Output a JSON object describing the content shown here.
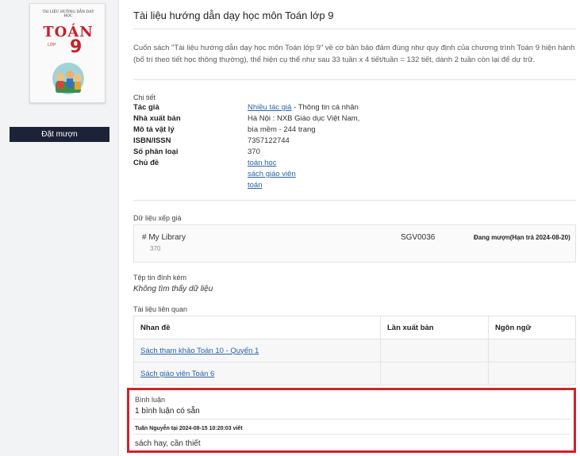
{
  "book": {
    "cover_title": "TOÁN",
    "cover_top_text": "TÀI LIỆU HƯỚNG DẪN DẠY HỌC",
    "cover_grade_label": "LỚP",
    "cover_grade_number": "9"
  },
  "actions": {
    "borrow_label": "Đặt mượn"
  },
  "header": {
    "title": "Tài liệu hướng dẫn dạy học môn Toán lớp 9",
    "description": "Cuốn sách \"Tài liệu hướng dẫn dạy học môn Toán lớp 9\" về cơ bản bảo đảm đúng như quy định của chương trình Toán 9 hiện hành (bố trí theo tiết học thông thường), thể hiện cụ thể như sau 33 tuần x 4 tiết/tuần = 132 tiết, dành 2 tuần còn lại để dự trữ."
  },
  "details": {
    "section_label": "Chi tiết",
    "author_key": "Tác giả",
    "author_link": "Nhiều tác giả",
    "author_suffix": "- Thông tin cá nhân",
    "publisher_key": "Nhà xuất bản",
    "publisher_val": "Hà Nội : NXB Giáo dục Việt Nam,",
    "physical_key": "Mô tả vật lý",
    "physical_val": "bìa mềm - 244 trang",
    "isbn_key": "ISBN/ISSN",
    "isbn_val": "7357122744",
    "class_key": "Số phân loại",
    "class_val": "370",
    "subject_key": "Chủ đề",
    "subjects": [
      "toán học",
      "sách giáo viên",
      "toán"
    ]
  },
  "holdings": {
    "section_label": "Dữ liệu xếp giá",
    "library": "# My Library",
    "call_number": "370",
    "barcode": "SGV0036",
    "status": "Đang mượn(Hạn trả 2024-08-20)"
  },
  "attachments": {
    "section_label": "Tệp tin đính kèm",
    "empty_text": "Không tìm thấy dữ liệu"
  },
  "related": {
    "section_label": "Tài liệu liên quan",
    "headers": [
      "Nhan đề",
      "Lần xuất bản",
      "Ngôn ngữ"
    ],
    "rows": [
      {
        "title": "Sách tham khảo Toán 10 - Quyển 1",
        "edition": "",
        "language": ""
      },
      {
        "title": "Sách giáo viên Toán 6",
        "edition": "",
        "language": ""
      }
    ]
  },
  "comments": {
    "section_label": "Bình luận",
    "count_text": "1 bình luận có sẵn",
    "items": [
      {
        "meta": "Tuấn Nguyễn tại 2024-08-15 10:20:03 viết",
        "text": "sách hay, cần thiết"
      }
    ]
  },
  "colors": {
    "accent_button": "#1c2237",
    "link": "#2a63a8",
    "highlight_border": "#d1202a"
  }
}
